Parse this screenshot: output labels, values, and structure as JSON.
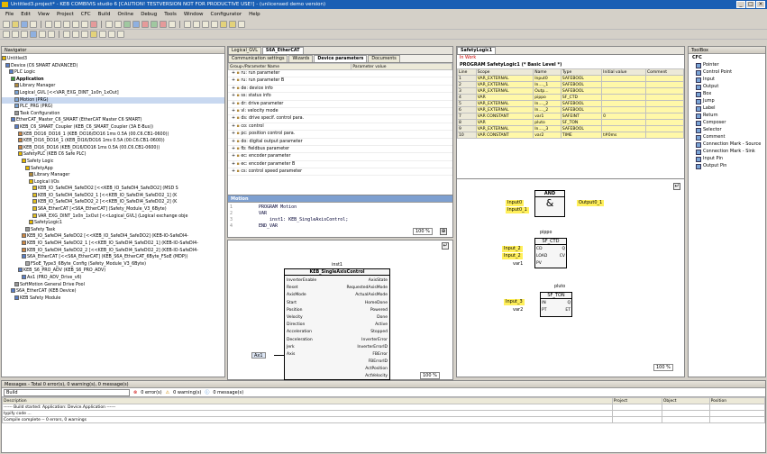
{
  "window": {
    "title": "Untitled3.project* - KEB COMBIVIS studio 6 [CAUTION! TESTVERSION NOT FOR PRODUCTIVE USE!] - (unlicensed demo version)",
    "buttons": [
      "_",
      "□",
      "×"
    ]
  },
  "menu": [
    "File",
    "Edit",
    "View",
    "Project",
    "CFC",
    "Build",
    "Online",
    "Debug",
    "Tools",
    "Window",
    "Configurator",
    "Help"
  ],
  "navigator": {
    "title": "Navigator",
    "items": [
      "Untitled3",
      "Device (C6 SMART ADVANCED)",
      "PLC Logic",
      "Application",
      "Library Manager",
      "Logical_GVL [<<VAR_EXG_DINT_1x0n_1xOut]",
      "Motion (PRG)",
      "PLC_PRG (PRG)",
      "Task Configuration",
      "EtherCAT_Master_C6_SMART (EtherCAT Master C6 SMART)",
      "KEB_C6_SMART_Coupler (KEB_C6_SMART_Coupler (3A E-Bus))",
      "KEB_DO16_DO16_1 (KEB_DO16/DO16 1ms 0.5A (00.C6.CB1-0600))",
      "KEB_DI16_DO16_1 (KEB_DI16/DO16 1ms 0.5A (00.C6.CB1-0600))",
      "KEB_DI16_DO16 (KEB_DI16/DO16 1ms 0.5A (00.C6.CB1-0600))",
      "SafetyPLC (KEB C6 Safe PLC)",
      "Safety Logic",
      "SafetyApp",
      "Library Manager",
      "Logical I/Os",
      "KEB_IO_SafeDI4_SafeDO2 [<<KEB_IO_SafeDI4_SafeDO2] (MSD S",
      "KEB_IO_SafeDI4_SafeDO2_1 [<<KEB_IO_SafeDI4_SafeDO2_1] (K",
      "KEB_IO_SafeDI4_SafeDO2_2 [<<KEB_IO_SafeDI4_SafeDO2_2] (K",
      "S6A_EtherCAT [<S6A_EtherCAT] (Safety_Module_V3_6Byte)",
      "VAR_EXG_DINT_1x0n_1xOut [<<Logical_GVL] (Logical exchange obje",
      "SafetyLogic1",
      "Safety Task",
      "KEB_IO_SafeDI4_SafeDO2 [<<KEB_IO_SafeDI4_SafeDO2] (KEB-IO-SafeDI4-",
      "KEB_IO_SafeDI4_SafeDO2_1 [<<KEB_IO_SafeDI4_SafeDO2_1] (KEB-IO-SafeDI4-",
      "KEB_IO_SafeDI4_SafeDO2_2 [<<KEB_IO_SafeDI4_SafeDO2_2] (KEB-IO-SafeDI4-",
      "S6A_EtherCAT [<<S6A_EtherCAT] (KEB_S6A_EtherCAT_6Byte_FSoE (MDP))",
      "FSoE_Type3_6Byte_Config (Safety_Module_V3_6Byte)",
      "KEB_S6_PRO_ADV (KEB_S6_PRO_ADV)",
      "Ax1 (PRO_ADV_Drive_v6)",
      "SoftMotion General Drive Pool",
      "S6A_EtherCAT (KEB Device)",
      "KEB Safety Module"
    ]
  },
  "device_editor": {
    "tabs": [
      "Logical_GVL",
      "S6A_EtherCAT"
    ],
    "subtabs": [
      "Communication settings",
      "Wizards",
      "Device parameters",
      "Documents"
    ],
    "columns": [
      "Group-/Parameter Name",
      "Parameter value"
    ],
    "groups": [
      "ru: run parameter",
      "ru: run parameter B",
      "de: device info",
      "ss: status info",
      "dr: drive parameter",
      "vl: velocity mode",
      "ds: drive specif. control para.",
      "co: control",
      "pc: position control para.",
      "do: digital output parameter",
      "fb: fieldbus parameter",
      "ec: encoder parameter",
      "ec: encoder parameter B",
      "cs: control speed parameter"
    ]
  },
  "motion_editor": {
    "title": "Motion",
    "code": [
      "PROGRAM Motion",
      "VAR",
      "    inst1: KEB_SingleAxisControl;",
      "END_VAR"
    ],
    "zoom": "100 %",
    "block": {
      "instance": "inst1",
      "type": "KEB_SingleAxisControl",
      "inputs": [
        "InverterEnable",
        "Reset",
        "AxisMode",
        "Start",
        "Position",
        "Velocity",
        "Direction",
        "Acceleration",
        "Deceleration",
        "Jerk",
        "Axis"
      ],
      "outputs": [
        "AxisState",
        "RequestedAxisMode",
        "ActualAxisMode",
        "HomeDone",
        "Powered",
        "Done",
        "Active",
        "Stopped",
        "InverterError",
        "InverterErrorID",
        "FBError",
        "FBErrorID",
        "ActPosition",
        "ActVelocity"
      ],
      "axis_var": "Ax1"
    },
    "zoom2": "100 %"
  },
  "safety_editor": {
    "tab": "SafetyLogic1",
    "status": "In Work",
    "program": "PROGRAM SafetyLogic1 (* Basic Level *)",
    "columns": [
      "Line",
      "Scope",
      "Name",
      "Type",
      "Initial value",
      "Comment"
    ],
    "rows": [
      [
        "1",
        "VAR_EXTERNAL",
        "Input0",
        "SAFEBOOL",
        "",
        ""
      ],
      [
        "2",
        "VAR_EXTERNAL",
        "In...._1",
        "SAFEBOOL",
        "",
        ""
      ],
      [
        "3",
        "VAR_EXTERNAL",
        "Outp...",
        "SAFEBOOL",
        "",
        ""
      ],
      [
        "4",
        "VAR",
        "pippo",
        "SF_CTD",
        "",
        ""
      ],
      [
        "5",
        "VAR_EXTERNAL",
        "In...._2",
        "SAFEBOOL",
        "",
        ""
      ],
      [
        "6",
        "VAR_EXTERNAL",
        "In...._2",
        "SAFEBOOL",
        "",
        ""
      ],
      [
        "7",
        "VAR CONSTANT",
        "var1",
        "SAFEINT",
        "0",
        ""
      ],
      [
        "8",
        "VAR",
        "pluto",
        "SF_TON",
        "",
        ""
      ],
      [
        "9",
        "VAR_EXTERNAL",
        "In...._3",
        "SAFEBOOL",
        "",
        ""
      ],
      [
        "10",
        "VAR CONSTANT",
        "var2",
        "TIME",
        "t#0ms",
        ""
      ]
    ],
    "and_block": {
      "type": "AND",
      "symbol": "&",
      "in1": "Input0",
      "in2": "Input0_1",
      "out": "Output0_1"
    },
    "ctd_block": {
      "instance": "pippo",
      "type": "SF_CTD",
      "pins_in": [
        "CD",
        "LOAD",
        "PV"
      ],
      "pins_out": [
        "Q",
        "CV"
      ],
      "in1": "Input_2",
      "in2": "Input_2",
      "in3": "var1"
    },
    "ton_block": {
      "instance": "pluto",
      "type": "SF_TON",
      "pins_in": [
        "IN",
        "PT"
      ],
      "pins_out": [
        "Q",
        "ET"
      ],
      "in1": "Input_3",
      "in2": "var2"
    },
    "zoom": "100 %"
  },
  "toolbox": {
    "title": "ToolBox",
    "section": "CFC",
    "items": [
      "Pointer",
      "Control Point",
      "Input",
      "Output",
      "Box",
      "Jump",
      "Label",
      "Return",
      "Composer",
      "Selector",
      "Comment",
      "Connection Mark - Source",
      "Connection Mark - Sink",
      "Input Pin",
      "Output Pin"
    ]
  },
  "messages": {
    "title": "Messages - Total 0 error(s), 0 warning(s), 0 message(s)",
    "filter": "Build",
    "errors": "0 error(s)",
    "warnings": "0 warning(s)",
    "msgs": "0 message(s)",
    "columns": [
      "Description",
      "Project",
      "Object",
      "Position"
    ],
    "lines": [
      "------ Build started: Application: Device.Application ------",
      "typify code ...",
      "Compile complete -- 0 errors, 0 warnings"
    ]
  }
}
